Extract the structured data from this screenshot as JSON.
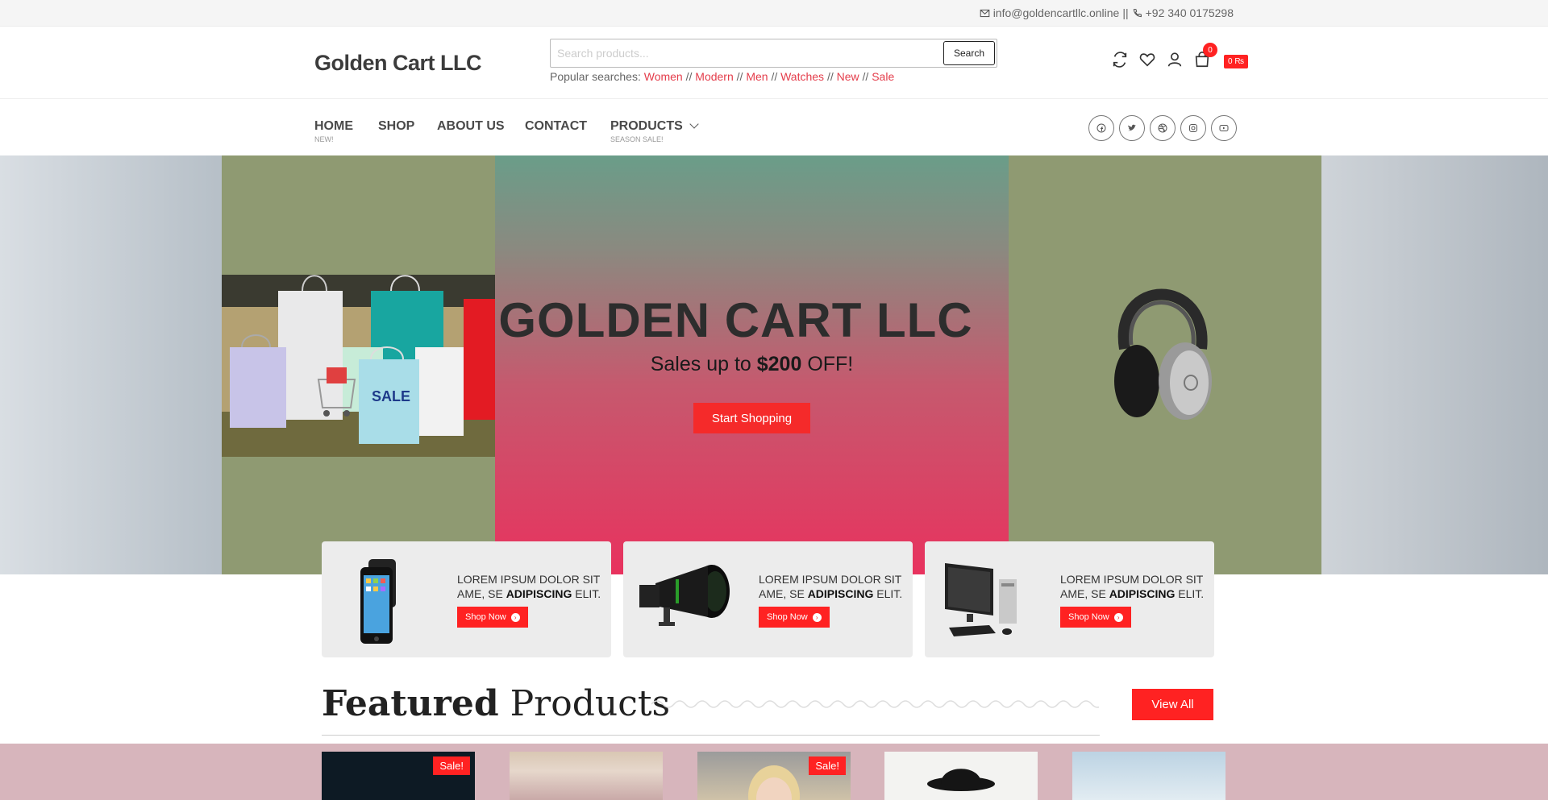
{
  "topbar": {
    "email": "info@goldencartllc.online",
    "separator": "||",
    "phone": "+92 340 0175298"
  },
  "header": {
    "logo": "Golden Cart LLC",
    "search": {
      "placeholder": "Search products...",
      "button_label": "Search"
    },
    "popular_label": "Popular searches:",
    "popular_tags": [
      "Women",
      "Modern",
      "Men",
      "Watches",
      "New",
      "Sale"
    ],
    "tag_separator": "//",
    "cart": {
      "count": "0",
      "total": "0 ₨"
    }
  },
  "nav": {
    "items": [
      {
        "label": "HOME",
        "sub": "NEW!"
      },
      {
        "label": "SHOP",
        "sub": ""
      },
      {
        "label": "ABOUT US",
        "sub": ""
      },
      {
        "label": "CONTACT",
        "sub": ""
      },
      {
        "label": "PRODUCTS",
        "sub": "SEASON SALE!"
      }
    ],
    "socials": [
      "facebook-icon",
      "twitter-icon",
      "dribbble-icon",
      "instagram-icon",
      "youtube-icon"
    ]
  },
  "hero": {
    "title": "GOLDEN CART LLC",
    "sub_prefix": "Sales up to ",
    "sub_amount": "$200",
    "sub_suffix": " OFF!",
    "button": "Start Shopping",
    "bag_label": "SALE"
  },
  "promos": [
    {
      "line1": "LOREM IPSUM DOLOR SIT",
      "line2_prefix": "AME, SE ",
      "line2_bold": "ADIPISCING",
      "line2_suffix": " ELIT.",
      "button": "Shop Now",
      "image": "smartphone"
    },
    {
      "line1": "LOREM IPSUM DOLOR SIT",
      "line2_prefix": "AME, SE ",
      "line2_bold": "ADIPISCING",
      "line2_suffix": " ELIT.",
      "button": "Shop Now",
      "image": "camera-lens"
    },
    {
      "line1": "LOREM IPSUM DOLOR SIT",
      "line2_prefix": "AME, SE ",
      "line2_bold": "ADIPISCING",
      "line2_suffix": " ELIT.",
      "button": "Shop Now",
      "image": "desktop-computer"
    }
  ],
  "featured": {
    "title_bold": "Featured",
    "title_rest": " Products",
    "view_all": "View All",
    "products": [
      {
        "sale": "Sale!"
      },
      {
        "sale": ""
      },
      {
        "sale": "Sale!"
      },
      {
        "sale": ""
      },
      {
        "sale": ""
      }
    ]
  },
  "colors": {
    "accent": "#f22222",
    "link": "#e43d4b",
    "logo": "#3c3c3c"
  }
}
